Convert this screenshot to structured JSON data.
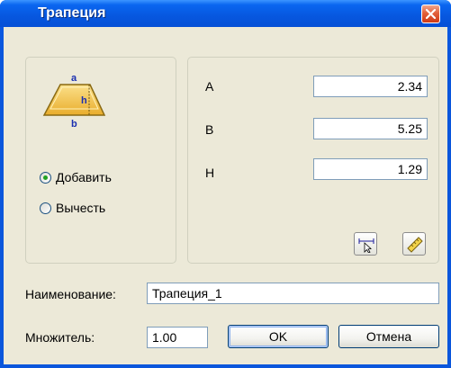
{
  "window": {
    "title": "Трапеция"
  },
  "shape": {
    "label_a": "a",
    "label_h": "h",
    "label_b": "b"
  },
  "mode": {
    "add_label": "Добавить",
    "subtract_label": "Вычесть",
    "selected": "add"
  },
  "params": [
    {
      "label": "A",
      "value": "2.34"
    },
    {
      "label": "B",
      "value": "5.25"
    },
    {
      "label": "H",
      "value": "1.29"
    }
  ],
  "name": {
    "label": "Наименование:",
    "value": "Трапеция_1"
  },
  "multiplier": {
    "label": "Множитель:",
    "value": "1.00"
  },
  "buttons": {
    "ok": "OK",
    "cancel": "Отмена"
  },
  "icons": {
    "close": "close-icon",
    "pick": "pick-distance-icon",
    "measure": "ruler-icon"
  },
  "colors": {
    "title_bar": "#0757df",
    "dialog_bg": "#ece9d8",
    "close_btn": "#e2603a",
    "shape_fill": "#f5c94a"
  }
}
